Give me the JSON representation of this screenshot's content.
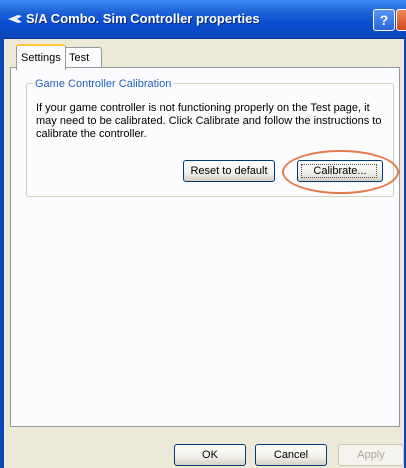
{
  "window": {
    "title": "S/A Combo. Sim Controller properties",
    "help_label": "?"
  },
  "tabs": [
    {
      "label": "Settings",
      "active": true
    },
    {
      "label": "Test",
      "active": false
    }
  ],
  "calibration_group": {
    "legend": "Game Controller Calibration",
    "description": "If your game controller is not functioning properly on the Test page, it may need to be calibrated.  Click Calibrate and follow the instructions to calibrate the controller.",
    "reset_label": "Reset to default",
    "calibrate_label": "Calibrate..."
  },
  "footer": {
    "ok_label": "OK",
    "cancel_label": "Cancel",
    "apply_label": "Apply"
  },
  "colors": {
    "titlebar": "#0b45b8",
    "legend_text": "#1f5fbf",
    "highlight_ring": "#e07a4a"
  }
}
